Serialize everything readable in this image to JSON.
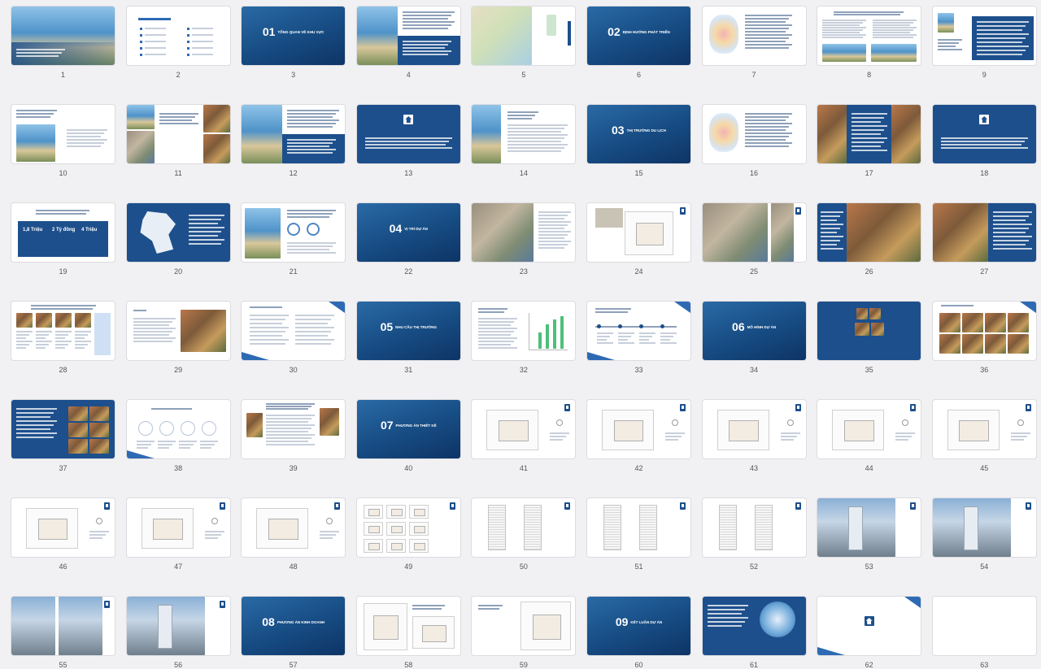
{
  "slides": [
    {
      "n": "1",
      "theme": "t-white",
      "layout": "cover"
    },
    {
      "n": "2",
      "theme": "t-white",
      "layout": "toc"
    },
    {
      "n": "3",
      "theme": "t-ocean",
      "layout": "section",
      "sec": "01",
      "sub": "TỔNG QUAN VỀ KHU VỰC"
    },
    {
      "n": "4",
      "theme": "t-white",
      "layout": "imgtext"
    },
    {
      "n": "5",
      "theme": "t-white",
      "layout": "map"
    },
    {
      "n": "6",
      "theme": "t-ocean",
      "layout": "section",
      "sec": "02",
      "sub": "ĐỊNH HƯỚNG PHÁT TRIỂN"
    },
    {
      "n": "7",
      "theme": "t-white",
      "layout": "maptext"
    },
    {
      "n": "8",
      "theme": "t-white",
      "layout": "twoimg"
    },
    {
      "n": "9",
      "theme": "t-white",
      "layout": "imgbox"
    },
    {
      "n": "10",
      "theme": "t-white",
      "layout": "imgtext2"
    },
    {
      "n": "11",
      "theme": "t-white",
      "layout": "collage"
    },
    {
      "n": "12",
      "theme": "t-white",
      "layout": "imgtext"
    },
    {
      "n": "13",
      "theme": "t-blue",
      "layout": "logoblue"
    },
    {
      "n": "14",
      "theme": "t-white",
      "layout": "mapleft"
    },
    {
      "n": "15",
      "theme": "t-ocean",
      "layout": "section",
      "sec": "03",
      "sub": "THỊ TRƯỜNG DU LỊCH"
    },
    {
      "n": "16",
      "theme": "t-white",
      "layout": "maptext"
    },
    {
      "n": "17",
      "theme": "t-white",
      "layout": "marketsplit"
    },
    {
      "n": "18",
      "theme": "t-blue",
      "layout": "logoblue"
    },
    {
      "n": "19",
      "theme": "t-white",
      "layout": "stats",
      "stats": [
        "1,8 Triệu",
        "2 Tỷ đồng",
        "4 Triệu"
      ]
    },
    {
      "n": "20",
      "theme": "t-blue",
      "layout": "worldmap"
    },
    {
      "n": "21",
      "theme": "t-white",
      "layout": "family"
    },
    {
      "n": "22",
      "theme": "t-ocean",
      "layout": "section",
      "sec": "04",
      "sub": "VỊ TRÍ DỰ ÁN"
    },
    {
      "n": "23",
      "theme": "t-white",
      "layout": "aerialtext"
    },
    {
      "n": "24",
      "theme": "t-white",
      "layout": "planleft"
    },
    {
      "n": "25",
      "theme": "t-white",
      "layout": "aerialtwo"
    },
    {
      "n": "26",
      "theme": "t-white",
      "layout": "marketsplit2"
    },
    {
      "n": "27",
      "theme": "t-white",
      "layout": "marketsplit3"
    },
    {
      "n": "28",
      "theme": "t-white",
      "layout": "fourimg"
    },
    {
      "n": "29",
      "theme": "t-white",
      "layout": "textimg"
    },
    {
      "n": "30",
      "theme": "t-white",
      "layout": "textlist"
    },
    {
      "n": "31",
      "theme": "t-ocean",
      "layout": "section",
      "sec": "05",
      "sub": "NHU CẦU THỊ TRƯỜNG"
    },
    {
      "n": "32",
      "theme": "t-white",
      "layout": "chart"
    },
    {
      "n": "33",
      "theme": "t-white",
      "layout": "timeline"
    },
    {
      "n": "34",
      "theme": "t-ocean",
      "layout": "section",
      "sec": "06",
      "sub": "MÔ HÌNH DỰ ÁN"
    },
    {
      "n": "35",
      "theme": "t-blue",
      "layout": "bluephotos"
    },
    {
      "n": "36",
      "theme": "t-white",
      "layout": "photogrid"
    },
    {
      "n": "37",
      "theme": "t-blue",
      "layout": "bluephotos2"
    },
    {
      "n": "38",
      "theme": "t-white",
      "layout": "diagram"
    },
    {
      "n": "39",
      "theme": "t-white",
      "layout": "textphotos"
    },
    {
      "n": "40",
      "theme": "t-ocean",
      "layout": "section",
      "sec": "07",
      "sub": "PHƯƠNG ÁN THIẾT KẾ"
    },
    {
      "n": "41",
      "theme": "t-white",
      "layout": "floorplan"
    },
    {
      "n": "42",
      "theme": "t-white",
      "layout": "floorplan"
    },
    {
      "n": "43",
      "theme": "t-white",
      "layout": "floorplan"
    },
    {
      "n": "44",
      "theme": "t-white",
      "layout": "floorplan"
    },
    {
      "n": "45",
      "theme": "t-white",
      "layout": "floorplan"
    },
    {
      "n": "46",
      "theme": "t-white",
      "layout": "floorplan"
    },
    {
      "n": "47",
      "theme": "t-white",
      "layout": "floorplan"
    },
    {
      "n": "48",
      "theme": "t-white",
      "layout": "floorplan"
    },
    {
      "n": "49",
      "theme": "t-white",
      "layout": "unitplans"
    },
    {
      "n": "50",
      "theme": "t-white",
      "layout": "elevations"
    },
    {
      "n": "51",
      "theme": "t-white",
      "layout": "elevations"
    },
    {
      "n": "52",
      "theme": "t-white",
      "layout": "elevations"
    },
    {
      "n": "53",
      "theme": "t-white",
      "layout": "render"
    },
    {
      "n": "54",
      "theme": "t-white",
      "layout": "render"
    },
    {
      "n": "55",
      "theme": "t-white",
      "layout": "render2"
    },
    {
      "n": "56",
      "theme": "t-white",
      "layout": "render"
    },
    {
      "n": "57",
      "theme": "t-ocean",
      "layout": "section",
      "sec": "08",
      "sub": "PHƯƠNG ÁN KINH DOANH"
    },
    {
      "n": "58",
      "theme": "t-white",
      "layout": "table"
    },
    {
      "n": "59",
      "theme": "t-white",
      "layout": "table2"
    },
    {
      "n": "60",
      "theme": "t-ocean",
      "layout": "section",
      "sec": "09",
      "sub": "KẾT LUẬN DỰ ÁN"
    },
    {
      "n": "61",
      "theme": "t-blue",
      "layout": "finale"
    },
    {
      "n": "62",
      "theme": "t-white",
      "layout": "logowhite"
    },
    {
      "n": "63",
      "theme": "t-white",
      "layout": "blank"
    }
  ]
}
